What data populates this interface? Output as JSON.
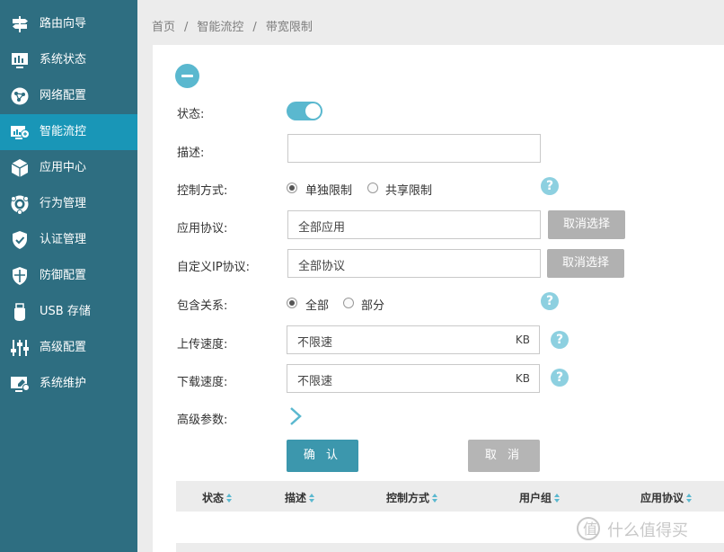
{
  "sidebar": {
    "items": [
      {
        "label": "路由向导",
        "icon": "signpost-icon"
      },
      {
        "label": "系统状态",
        "icon": "monitor-icon"
      },
      {
        "label": "网络配置",
        "icon": "globe-icon"
      },
      {
        "label": "智能流控",
        "icon": "flow-control-icon",
        "active": true
      },
      {
        "label": "应用中心",
        "icon": "cube-icon"
      },
      {
        "label": "行为管理",
        "icon": "shield-user-icon"
      },
      {
        "label": "认证管理",
        "icon": "shield-check-icon"
      },
      {
        "label": "防御配置",
        "icon": "shield-icon"
      },
      {
        "label": "USB 存储",
        "icon": "usb-icon"
      },
      {
        "label": "高级配置",
        "icon": "sliders-icon"
      },
      {
        "label": "系统维护",
        "icon": "maintenance-icon"
      }
    ]
  },
  "breadcrumb": {
    "home": "首页",
    "section": "智能流控",
    "page": "带宽限制",
    "separator": "/"
  },
  "form": {
    "status": {
      "label": "状态:",
      "enabled": true
    },
    "description": {
      "label": "描述:",
      "value": ""
    },
    "control_mode": {
      "label": "控制方式:",
      "options": [
        "单独限制",
        "共享限制"
      ],
      "selected": "单独限制"
    },
    "app_protocol": {
      "label": "应用协议:",
      "value": "全部应用",
      "button": "取消选择"
    },
    "custom_ip_protocol": {
      "label": "自定义IP协议:",
      "value": "全部协议",
      "button": "取消选择"
    },
    "inclusion": {
      "label": "包含关系:",
      "options": [
        "全部",
        "部分"
      ],
      "selected": "全部"
    },
    "upload_speed": {
      "label": "上传速度:",
      "value": "不限速",
      "unit": "KB"
    },
    "download_speed": {
      "label": "下载速度:",
      "value": "不限速",
      "unit": "KB"
    },
    "advanced": {
      "label": "高级参数:"
    },
    "help_glyph": "?"
  },
  "actions": {
    "confirm": "确 认",
    "cancel": "取 消"
  },
  "table": {
    "columns": [
      "状态",
      "描述",
      "控制方式",
      "用户组",
      "应用协议"
    ]
  },
  "watermark": {
    "text": "什么值得买"
  },
  "colors": {
    "sidebar_bg": "#2e6e81",
    "sidebar_active": "#1996b7",
    "accent": "#5ab8cf",
    "confirm_btn": "#3c97ad",
    "gray_btn": "#b1b1b1"
  }
}
